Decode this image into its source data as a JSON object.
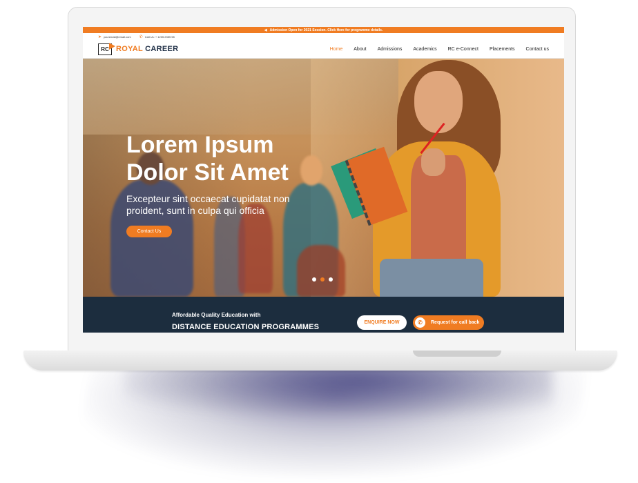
{
  "announcement": "Admission Open for 2021 Session. Click Here for programme details.",
  "contact": {
    "email": "youremail@email.com",
    "phone": "Call Us: + 1235 2355 98"
  },
  "logo": {
    "mark": "RC",
    "brand_part1": "ROYAL",
    "brand_part2": "CAREER"
  },
  "nav": {
    "items": [
      "Home",
      "About",
      "Admissions",
      "Academics",
      "RC e-Connect",
      "Placements",
      "Contact us"
    ],
    "active": "Home"
  },
  "hero": {
    "title_line1": "Lorem Ipsum",
    "title_line2": "Dolor Sit Amet",
    "subtitle": "Excepteur sint occaecat cupidatat non proident, sunt in culpa qui officia",
    "button_label": "Contact Us",
    "slides": 3,
    "active_slide": 2
  },
  "banner": {
    "tagline": "Affordable Quality Education with",
    "heading": "DISTANCE EDUCATION PROGRAMMES",
    "enquire_label": "ENQUIRE NOW",
    "callback_label": "Request for call back"
  },
  "colors": {
    "accent": "#f07c22",
    "navy": "#1c2d3e"
  },
  "icons": {
    "announcement": "megaphone-icon",
    "email": "send-icon",
    "phone": "phone-icon"
  }
}
